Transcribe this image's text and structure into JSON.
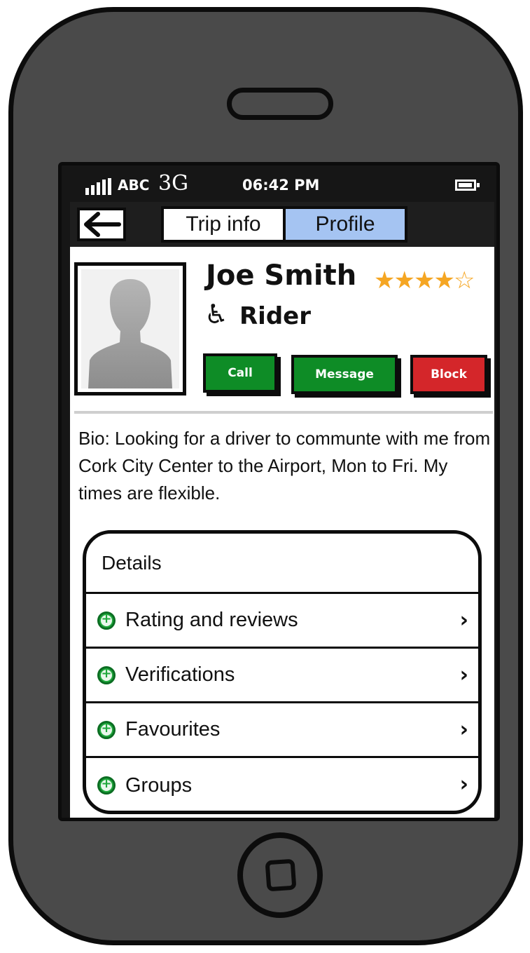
{
  "status_bar": {
    "carrier": "ABC",
    "network": "3G",
    "time": "06:42 PM"
  },
  "nav": {
    "tabs": [
      {
        "label": "Trip info",
        "active": false
      },
      {
        "label": "Profile",
        "active": true
      }
    ],
    "back_icon": "arrow-left-icon"
  },
  "profile": {
    "name": "Joe Smith",
    "rating": 4,
    "rating_max": 5,
    "role": "Rider",
    "role_icon": "wheelchair-icon",
    "buttons": {
      "call": "Call",
      "message": "Message",
      "block": "Block"
    },
    "bio": "Bio: Looking for a driver to communte with me from Cork City Center to the Airport, Mon to Fri. My times are flexible."
  },
  "details": {
    "title": "Details",
    "items": [
      {
        "label": "Rating and reviews",
        "icon": "plus-circle-icon"
      },
      {
        "label": "Verifications",
        "icon": "plus-circle-icon"
      },
      {
        "label": "Favourites",
        "icon": "plus-circle-icon"
      },
      {
        "label": "Groups",
        "icon": "plus-circle-icon"
      }
    ]
  },
  "colors": {
    "active_tab": "#a5c4f2",
    "call_button": "#0e8c26",
    "message_button": "#0e8c26",
    "block_button": "#d4262a",
    "stars": "#f5a623",
    "plus_icon": "#1fa83c"
  }
}
